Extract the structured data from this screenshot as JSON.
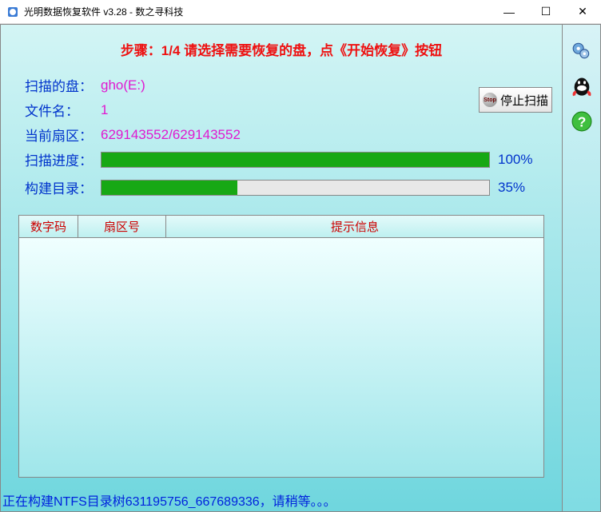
{
  "window": {
    "title": "光明数据恢复软件 v3.28 - 数之寻科技"
  },
  "step_line": "步骤：1/4 请选择需要恢复的盘，点《开始恢复》按钮",
  "info": {
    "disk_label": "扫描的盘：",
    "disk_value": "gho(E:)",
    "file_label": "文件名：",
    "file_value": "1",
    "sector_label": "当前扇区：",
    "sector_value": "629143552/629143552"
  },
  "progress": {
    "scan_label": "扫描进度：",
    "scan_pct": 100,
    "scan_text": "100%",
    "build_label": "构建目录：",
    "build_pct": 35,
    "build_text": "35%"
  },
  "stop_button": "停止扫描",
  "grid": {
    "col1": "数字码",
    "col2": "扇区号",
    "col3": "提示信息",
    "rows": []
  },
  "status": "正在构建NTFS目录树631195756_667689336，请稍等。。。"
}
